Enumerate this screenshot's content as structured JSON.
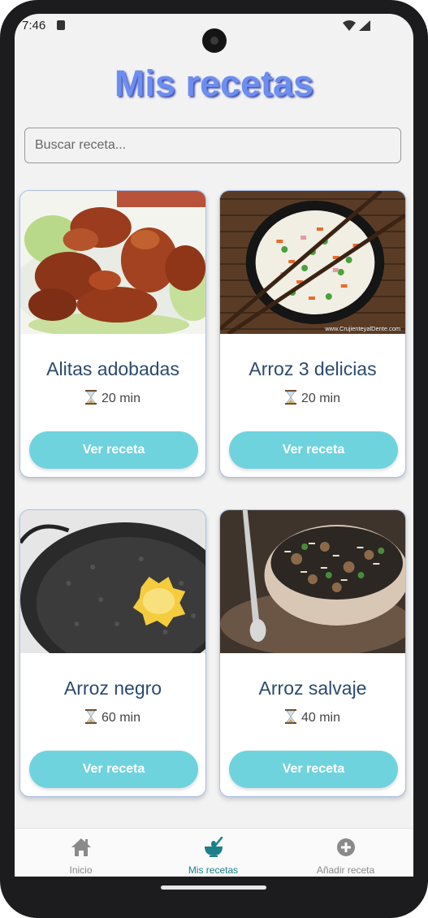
{
  "status_bar": {
    "time": "7:46"
  },
  "header": {
    "title": "Mis recetas"
  },
  "search": {
    "placeholder": "Buscar receta..."
  },
  "recipes": [
    {
      "name": "Alitas adobadas",
      "time": "20 min",
      "button": "Ver receta",
      "image": "chicken-wings"
    },
    {
      "name": "Arroz 3 delicias",
      "time": "20 min",
      "button": "Ver receta",
      "image": "fried-rice",
      "image_watermark": "www.CrujienteyalDente.com"
    },
    {
      "name": "Arroz negro",
      "time": "60 min",
      "button": "Ver receta",
      "image": "black-rice-paella"
    },
    {
      "name": "Arroz salvaje",
      "time": "40 min",
      "button": "Ver receta",
      "image": "wild-rice"
    }
  ],
  "nav": {
    "items": [
      {
        "label": "Inicio",
        "icon": "home-icon"
      },
      {
        "label": "Mis recetas",
        "icon": "bowl-icon",
        "active": true
      },
      {
        "label": "Añadir receta",
        "icon": "plus-circle-icon"
      }
    ]
  },
  "colors": {
    "title": "#6d8ef0",
    "button": "#6fd3de",
    "card_title": "#2b4a6f",
    "nav_active": "#1d7f8c",
    "nav_inactive": "#8a8a8a"
  }
}
